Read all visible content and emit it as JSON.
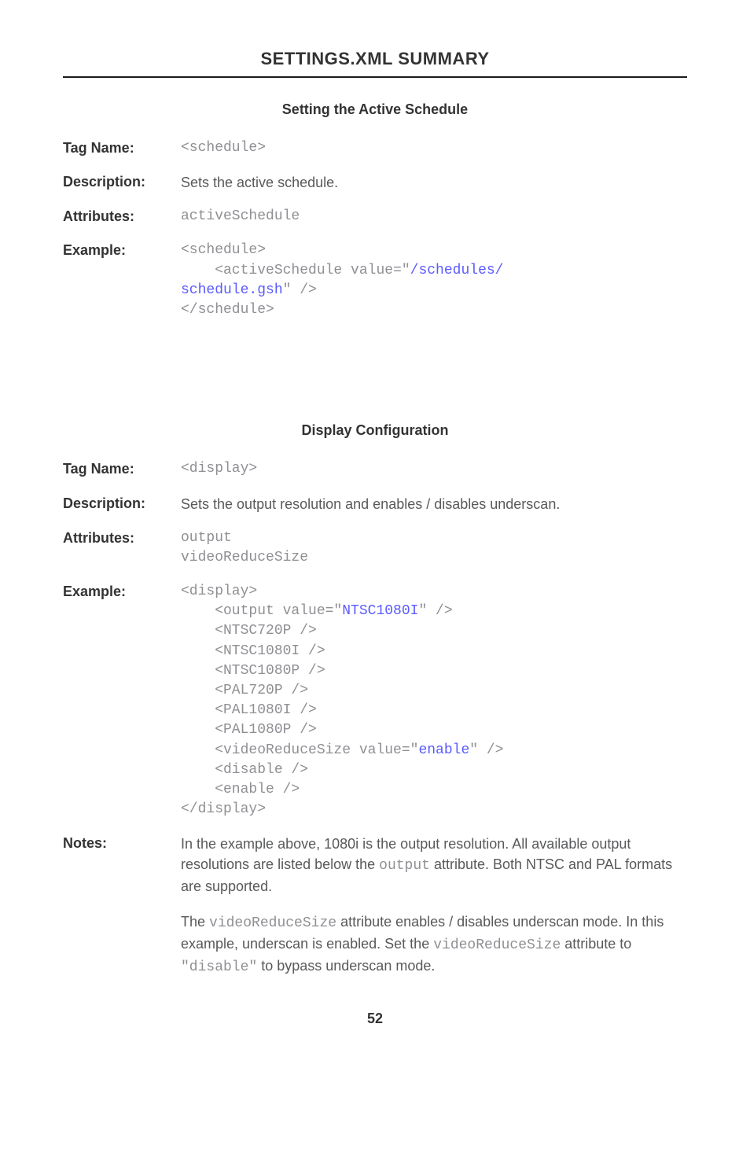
{
  "header": {
    "title": "SETTINGS.XML SUMMARY"
  },
  "section1": {
    "heading": "Setting the Active Schedule",
    "tagName": {
      "label": "Tag Name:",
      "value": "<schedule>"
    },
    "description": {
      "label": "Description:",
      "value": "Sets the active schedule."
    },
    "attributes": {
      "label": "Attributes:",
      "value": "activeSchedule"
    },
    "example": {
      "label": "Example:",
      "line1": "<schedule>",
      "line2a": "    <activeSchedule value=\"",
      "line2b": "/schedules/",
      "line3a": "schedule.gsh",
      "line3b": "\" />",
      "line4": "</schedule>"
    }
  },
  "section2": {
    "heading": "Display Configuration",
    "tagName": {
      "label": "Tag Name:",
      "value": "<display>"
    },
    "description": {
      "label": "Description:",
      "value": "Sets the output resolution and enables / disables underscan."
    },
    "attributes": {
      "label": "Attributes:",
      "line1": "output",
      "line2": "videoReduceSize"
    },
    "example": {
      "label": "Example:",
      "l1": "<display>",
      "l2a": "    <output value=\"",
      "l2b": "NTSC1080I",
      "l2c": "\" />",
      "l3": "    <NTSC720P />",
      "l4": "    <NTSC1080I />",
      "l5": "    <NTSC1080P />",
      "l6": "    <PAL720P />",
      "l7": "    <PAL1080I />",
      "l8": "    <PAL1080P />",
      "l9a": "    <videoReduceSize value=\"",
      "l9b": "enable",
      "l9c": "\" />",
      "l10": "    <disable />",
      "l11": "    <enable />",
      "l12": "</display>"
    },
    "notes": {
      "label": "Notes:",
      "p1a": "In the example above, 1080i is the output resolution.  All available output resolutions are listed below the ",
      "p1b": "output",
      "p1c": " attribute.  Both NTSC and PAL formats are supported.",
      "p2a": "The ",
      "p2b": "videoReduceSize",
      "p2c": " attribute enables / disables underscan mode.  In this example, underscan is enabled.  Set the ",
      "p2d": "videoReduceSize",
      "p2e": " attribute to ",
      "p2f": "\"disable\"",
      "p2g": "  to bypass underscan mode."
    }
  },
  "pageNumber": "52"
}
